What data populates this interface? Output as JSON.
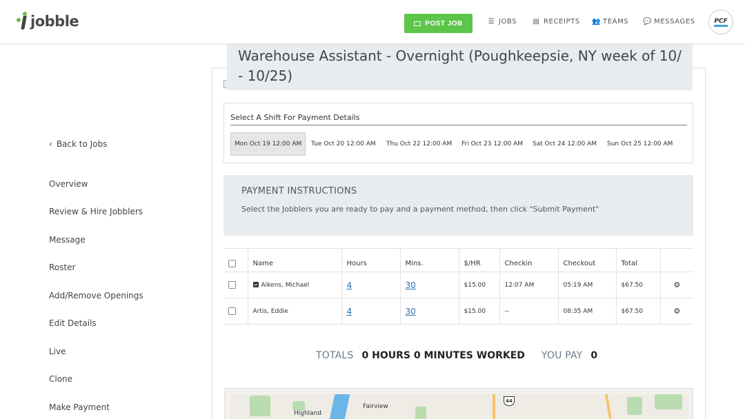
{
  "header": {
    "logo_text": "jobble",
    "post_job_label": "POST JOB",
    "nav": [
      {
        "label": "JOBS",
        "icon": "list-icon"
      },
      {
        "label": "RECEIPTS",
        "icon": "receipt-icon"
      },
      {
        "label": "TEAMS",
        "icon": "users-icon"
      },
      {
        "label": "MESSAGES",
        "icon": "chat-icon"
      }
    ],
    "avatar_text": "PCF"
  },
  "sidebar": {
    "back_label": "Back to Jobs",
    "items": [
      "Overview",
      "Review & Hire Jobblers",
      "Message",
      "Roster",
      "Add/Remove Openings",
      "Edit Details",
      "Live",
      "Clone",
      "Make Payment"
    ]
  },
  "job": {
    "title": "Warehouse Assistant - Overnight (Poughkeepsie, NY week of 10/ - 10/25)"
  },
  "shifts": {
    "heading": "Select A Shift For Payment Details",
    "items": [
      "Mon Oct 19 12:00 AM",
      "Tue Oct 20 12:00 AM",
      "Thu Oct 22 12:00 AM",
      "Fri Oct 23 12:00 AM",
      "Sat Oct 24 12:00 AM",
      "Sun Oct 25 12:00 AM"
    ],
    "selected_index": 0
  },
  "instructions": {
    "heading": "PAYMENT INSTRUCTIONS",
    "body": "Select the Jobblers you are ready to pay and a payment method, then click \"Submit Payment\""
  },
  "table": {
    "headers": [
      "Name",
      "Hours",
      "Mins.",
      "$/HR",
      "Checkin",
      "Checkout",
      "Total"
    ],
    "rows": [
      {
        "name": "Aikens, Michael",
        "hours": "4",
        "mins": "30",
        "rate": "$15.00",
        "checkin": "12:07 AM",
        "checkout": "05:19 AM",
        "total": "$67.50"
      },
      {
        "name": "Artis, Eddie",
        "hours": "4",
        "mins": "30",
        "rate": "$15.00",
        "checkin": "--",
        "checkout": "08:35 AM",
        "total": "$67.50"
      }
    ]
  },
  "totals": {
    "totals_label": "TOTALS",
    "worked_value": "0 HOURS 0 MINUTES WORKED",
    "pay_label": "YOU PAY",
    "pay_value": "0"
  },
  "map": {
    "labels": [
      "Highland",
      "Fairview"
    ],
    "route_number": "44"
  }
}
